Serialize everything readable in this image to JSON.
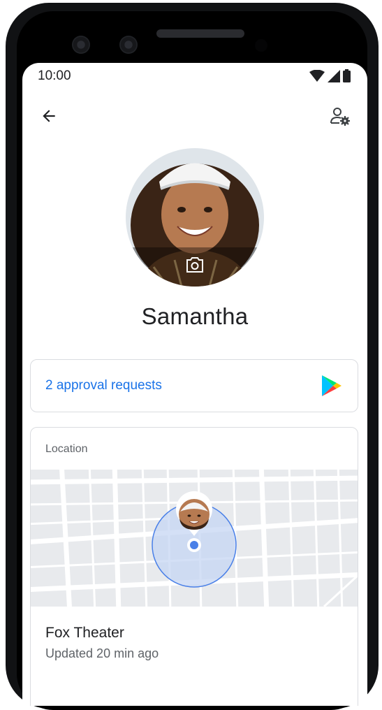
{
  "status_bar": {
    "time": "10:00"
  },
  "icons": {
    "back": "arrow-back-icon",
    "settings": "person-settings-icon",
    "camera": "camera-icon",
    "play": "google-play-icon",
    "wifi": "wifi-icon",
    "signal": "signal-icon",
    "battery": "battery-icon"
  },
  "profile": {
    "name": "Samantha"
  },
  "approvals": {
    "label": "2 approval requests"
  },
  "location": {
    "section_label": "Location",
    "place": "Fox Theater",
    "updated": "Updated 20 min ago"
  },
  "colors": {
    "accent": "#1a73e8",
    "map_bg": "#e8eaed",
    "accuracy_fill": "#c6d5f3"
  }
}
